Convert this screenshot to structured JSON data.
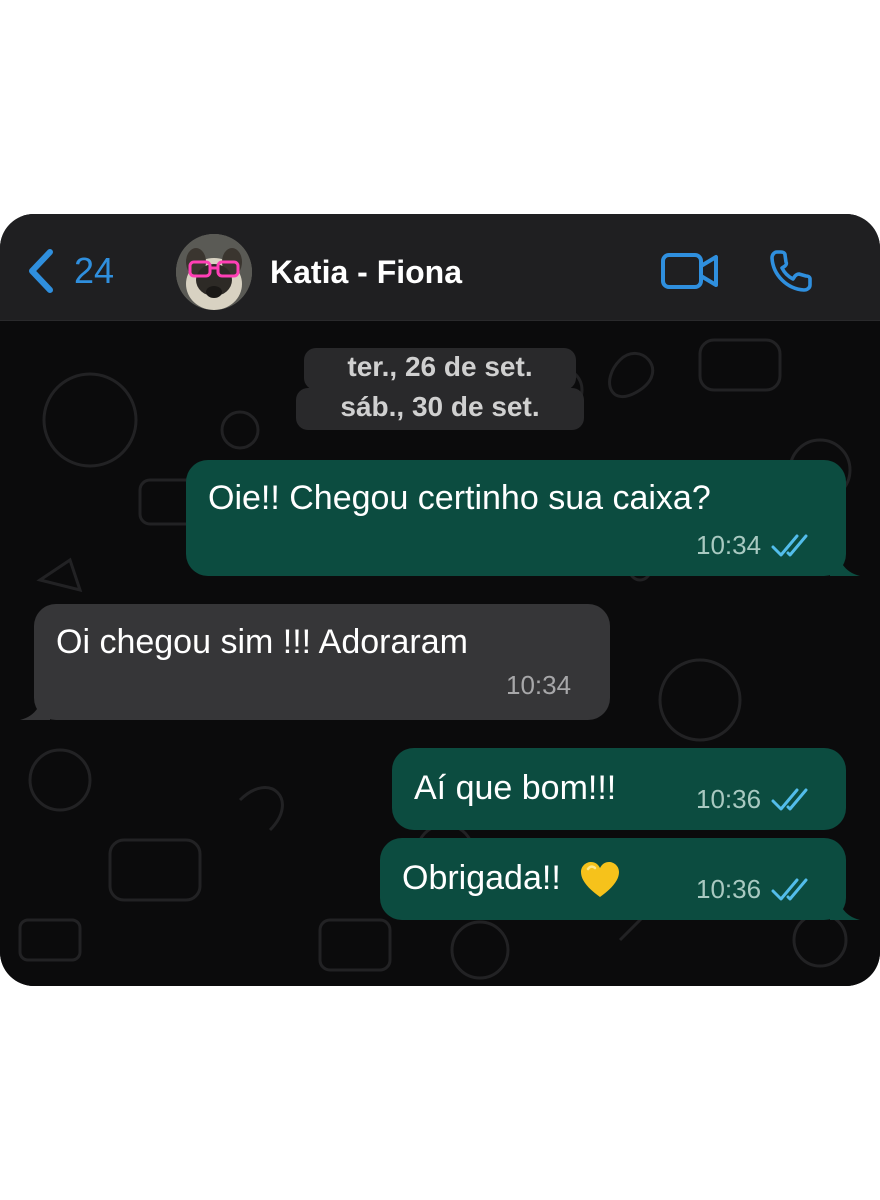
{
  "header": {
    "back_count": "24",
    "contact_name": "Katia - Fiona",
    "back_icon": "chevron-left-icon",
    "video_icon": "video-camera-icon",
    "call_icon": "phone-icon"
  },
  "dates": [
    "ter., 26 de set.",
    "sáb., 30 de set."
  ],
  "messages": [
    {
      "direction": "outgoing",
      "text": "Oie!! Chegou certinho sua caixa?",
      "time": "10:34",
      "status": "read"
    },
    {
      "direction": "incoming",
      "text": "Oi chegou sim !!! Adoraram",
      "time": "10:34"
    },
    {
      "direction": "outgoing",
      "text": "Aí que bom!!!",
      "time": "10:36",
      "status": "read"
    },
    {
      "direction": "outgoing",
      "text": "Obrigada!!",
      "time": "10:36",
      "status": "read",
      "emoji": "yellow-heart"
    }
  ],
  "colors": {
    "accent": "#2f8fde",
    "outgoing_bubble": "#0c4c40",
    "incoming_bubble": "#363638",
    "read_ticks": "#53bdeb"
  }
}
